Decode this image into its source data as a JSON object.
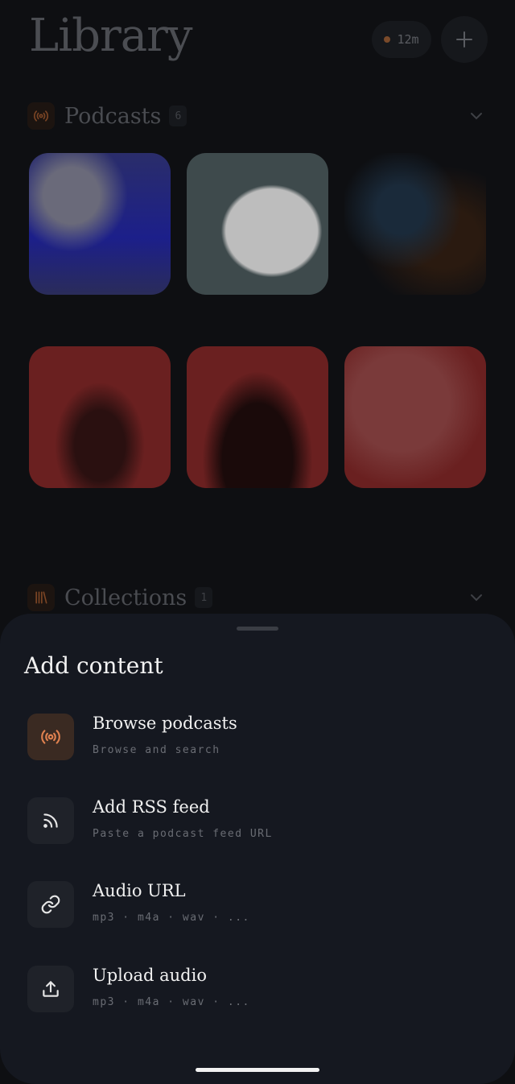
{
  "header": {
    "title": "Library",
    "timer_label": "12m"
  },
  "sections": {
    "podcasts": {
      "label": "Podcasts",
      "count": "6",
      "icon": "podcast-icon"
    },
    "collections": {
      "label": "Collections",
      "count": "1",
      "icon": "collection-icon"
    }
  },
  "sheet": {
    "title": "Add content",
    "items": [
      {
        "label": "Browse podcasts",
        "sub": "Browse and search",
        "icon": "podcast-icon"
      },
      {
        "label": "Add RSS feed",
        "sub": "Paste a podcast feed URL",
        "icon": "rss-icon"
      },
      {
        "label": "Audio URL",
        "sub": "mp3 · m4a · wav · ...",
        "icon": "link-icon"
      },
      {
        "label": "Upload audio",
        "sub": "mp3 · m4a · wav · ...",
        "icon": "upload-icon"
      }
    ]
  },
  "colors": {
    "accent": "#e0814f",
    "sheet_bg": "#151820"
  }
}
